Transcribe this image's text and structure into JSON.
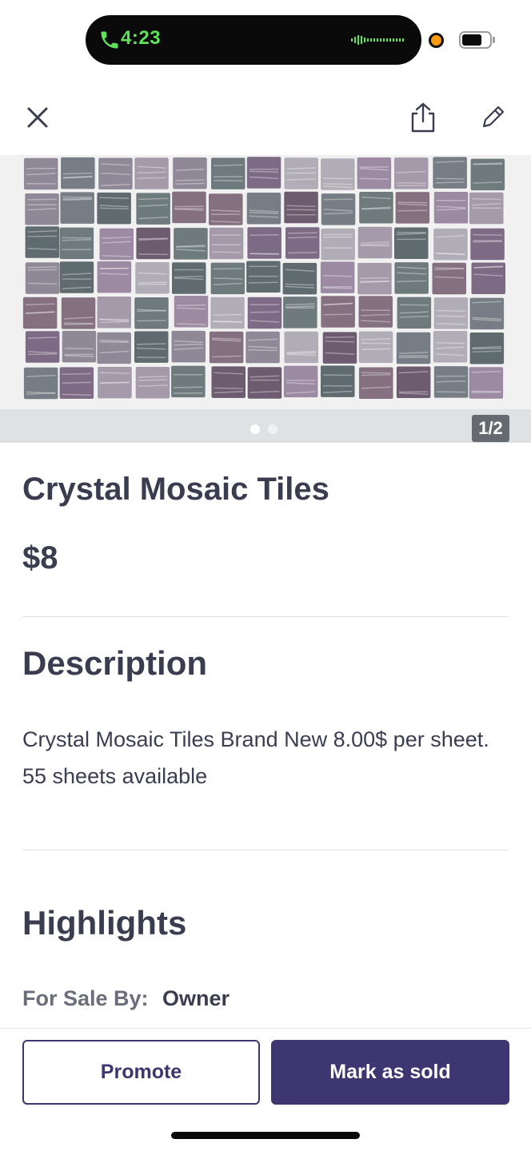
{
  "status_bar": {
    "call_time": "4:23",
    "call_color": "#5fe25a",
    "mic_indicator_color": "#f79a10",
    "icons": [
      "phone-icon",
      "waveform-icon",
      "battery-icon"
    ]
  },
  "toolbar": {
    "icons": [
      "close-icon",
      "share-icon",
      "edit-pencil-icon"
    ]
  },
  "gallery": {
    "counter": "1/2",
    "current_index": 1,
    "total": 2
  },
  "listing": {
    "title": "Crystal Mosaic Tiles",
    "price": "$8"
  },
  "description": {
    "heading": "Description",
    "text": "Crystal Mosaic Tiles Brand New 8.00$ per sheet. 55 sheets available"
  },
  "highlights": {
    "heading": "Highlights",
    "items": [
      {
        "label": "For Sale By:",
        "value": "Owner"
      }
    ]
  },
  "actions": {
    "promote_label": "Promote",
    "mark_sold_label": "Mark as sold",
    "accent_color": "#3d3670"
  }
}
